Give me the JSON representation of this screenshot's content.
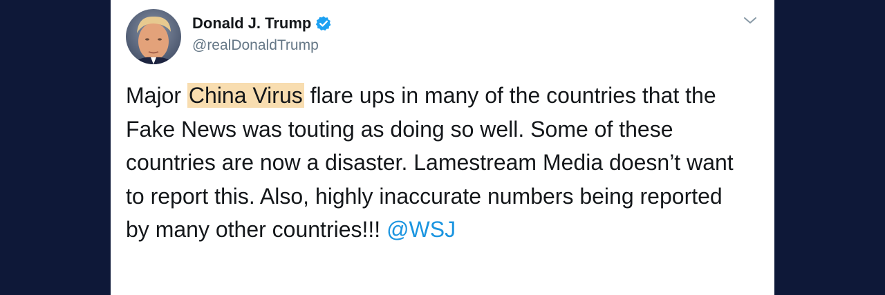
{
  "user": {
    "display_name": "Donald J. Trump",
    "handle": "@realDonaldTrump",
    "verified": true,
    "verified_icon": "verified-badge-icon"
  },
  "menu": {
    "icon": "chevron-down-icon"
  },
  "tweet": {
    "pre": "Major ",
    "highlight": "China Virus",
    "body": " flare ups in many of the countries that the Fake News was touting as doing so well. Some of these countries are now a disaster. Lamestream Media doesn’t want to report this. Also, highly inaccurate numbers being reported by many other countries!!! ",
    "mention": "@WSJ"
  },
  "colors": {
    "page_background": "#0e1838",
    "highlight": "#f8ddb0",
    "link": "#1b95e0",
    "verified": "#1da1f2"
  }
}
